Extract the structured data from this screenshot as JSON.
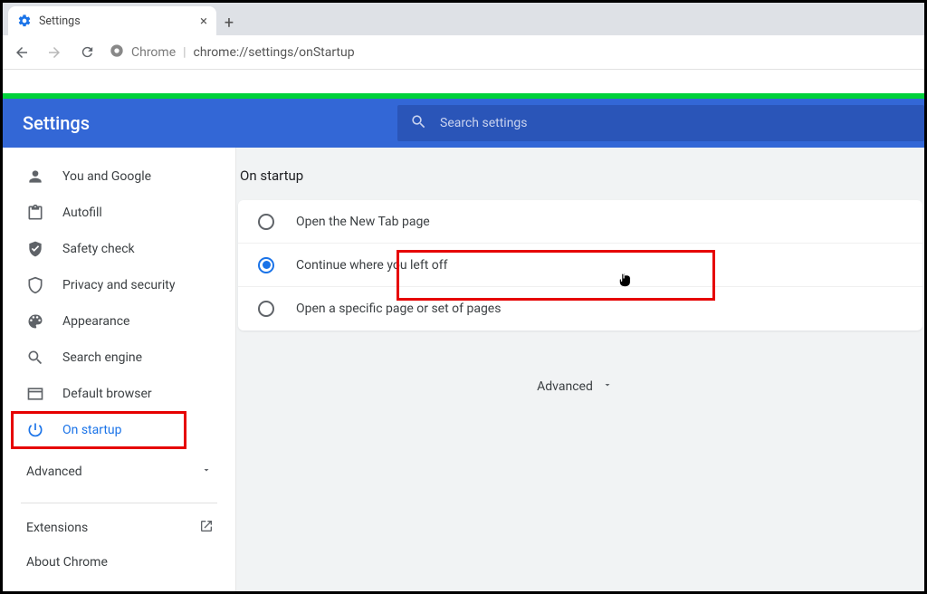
{
  "browser": {
    "tab_title": "Settings",
    "url_label": "Chrome",
    "url": "chrome://settings/onStartup"
  },
  "header": {
    "title": "Settings",
    "search_placeholder": "Search settings"
  },
  "sidebar": {
    "items": [
      {
        "label": "You and Google"
      },
      {
        "label": "Autofill"
      },
      {
        "label": "Safety check"
      },
      {
        "label": "Privacy and security"
      },
      {
        "label": "Appearance"
      },
      {
        "label": "Search engine"
      },
      {
        "label": "Default browser"
      },
      {
        "label": "On startup"
      }
    ],
    "advanced": "Advanced",
    "extensions": "Extensions",
    "about": "About Chrome"
  },
  "main": {
    "section_title": "On startup",
    "options": [
      {
        "label": "Open the New Tab page"
      },
      {
        "label": "Continue where you left off"
      },
      {
        "label": "Open a specific page or set of pages"
      }
    ],
    "advanced": "Advanced"
  }
}
